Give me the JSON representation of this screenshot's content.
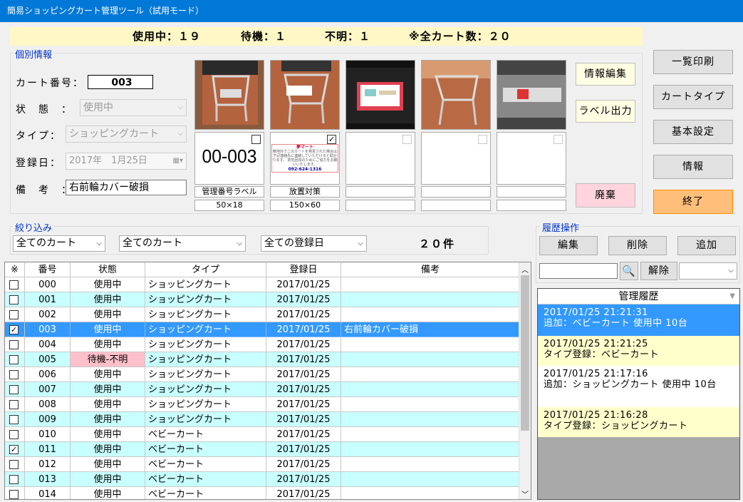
{
  "window": {
    "title": "簡易ショッピングカート管理ツール（試用モード）"
  },
  "summary": {
    "in_use": "使用中：１９",
    "standby": "待機：１",
    "unknown": "不明：１",
    "total": "※全カート数：２０"
  },
  "detail": {
    "group_label": "個別情報",
    "cart_no_label": "カート番号：",
    "cart_no": "003",
    "status_label": "状　態　：",
    "status": "使用中",
    "type_label": "タイプ：",
    "type": "ショッピングカート",
    "date_label": "登録日：",
    "date": "2017年　1月25日",
    "note_label": "備　考　：",
    "note": "右前輪カバー破損",
    "label_big": "00-003",
    "notice_title": "夢マート",
    "notice_body": "敷地外でこのカートを発見された場合は下記連絡先に連絡していただけると助かります。 防犯回収のためにご協力をお願いいたします。",
    "notice_phone": "092-624-1316",
    "captions": [
      "管理番号ラベル",
      "放置対策",
      "",
      "",
      ""
    ],
    "sizes": [
      "50×18",
      "150×60",
      "",
      "",
      ""
    ]
  },
  "buttons": {
    "edit_info": "情報編集",
    "label_out": "ラベル出力",
    "discard": "廃棄",
    "print_list": "一覧印刷",
    "cart_type": "カートタイプ",
    "basic_settings": "基本設定",
    "info": "情報",
    "exit": "終了"
  },
  "filter": {
    "group_label": "絞り込み",
    "f1": "全てのカート",
    "f2": "全てのカート",
    "f3": "全ての登録日",
    "count": "２０件"
  },
  "history_ops": {
    "group_label": "履歴操作",
    "edit": "編集",
    "delete": "削除",
    "add": "追加",
    "search_value": "",
    "clear": "解除",
    "select": ""
  },
  "table": {
    "headers": [
      "※",
      "番号",
      "状態",
      "タイプ",
      "登録日",
      "備考"
    ],
    "rows": [
      {
        "checked": false,
        "no": "000",
        "status": "使用中",
        "type": "ショッピングカート",
        "date": "2017/01/25",
        "note": ""
      },
      {
        "checked": false,
        "no": "001",
        "status": "使用中",
        "type": "ショッピングカート",
        "date": "2017/01/25",
        "note": ""
      },
      {
        "checked": false,
        "no": "002",
        "status": "使用中",
        "type": "ショッピングカート",
        "date": "2017/01/25",
        "note": ""
      },
      {
        "checked": true,
        "no": "003",
        "status": "使用中",
        "type": "ショッピングカート",
        "date": "2017/01/25",
        "note": "右前輪カバー破損"
      },
      {
        "checked": false,
        "no": "004",
        "status": "使用中",
        "type": "ショッピングカート",
        "date": "2017/01/25",
        "note": ""
      },
      {
        "checked": false,
        "no": "005",
        "status": "待機-不明",
        "type": "ショッピングカート",
        "date": "2017/01/25",
        "note": ""
      },
      {
        "checked": false,
        "no": "006",
        "status": "使用中",
        "type": "ショッピングカート",
        "date": "2017/01/25",
        "note": ""
      },
      {
        "checked": false,
        "no": "007",
        "status": "使用中",
        "type": "ショッピングカート",
        "date": "2017/01/25",
        "note": ""
      },
      {
        "checked": false,
        "no": "008",
        "status": "使用中",
        "type": "ショッピングカート",
        "date": "2017/01/25",
        "note": ""
      },
      {
        "checked": false,
        "no": "009",
        "status": "使用中",
        "type": "ショッピングカート",
        "date": "2017/01/25",
        "note": ""
      },
      {
        "checked": false,
        "no": "010",
        "status": "使用中",
        "type": "ベビーカート",
        "date": "2017/01/25",
        "note": ""
      },
      {
        "checked": true,
        "no": "011",
        "status": "使用中",
        "type": "ベビーカート",
        "date": "2017/01/25",
        "note": ""
      },
      {
        "checked": false,
        "no": "012",
        "status": "使用中",
        "type": "ベビーカート",
        "date": "2017/01/25",
        "note": ""
      },
      {
        "checked": false,
        "no": "013",
        "status": "使用中",
        "type": "ベビーカート",
        "date": "2017/01/25",
        "note": ""
      },
      {
        "checked": false,
        "no": "014",
        "status": "使用中",
        "type": "ベビーカート",
        "date": "2017/01/25",
        "note": ""
      }
    ]
  },
  "history": {
    "title": "管理履歴",
    "items": [
      {
        "time": "2017/01/25 21:21:31",
        "text": "追加：ベビーカート 使用中 10台"
      },
      {
        "time": "2017/01/25 21:21:25",
        "text": "タイプ登録：ベビーカート"
      },
      {
        "time": "2017/01/25 21:17:16",
        "text": "追加：ショッピングカート 使用中 10台"
      },
      {
        "time": "2017/01/25 21:16:28",
        "text": "タイプ登録：ショッピングカート"
      }
    ]
  },
  "colors": {
    "titlebar": "#0078d7",
    "selected_row": "#3399ff",
    "alt_row": "#c8ffff",
    "status_warn": "#ffc0cb",
    "summary_bg": "#fff8c6",
    "hist_yellow": "#ffffcc"
  }
}
